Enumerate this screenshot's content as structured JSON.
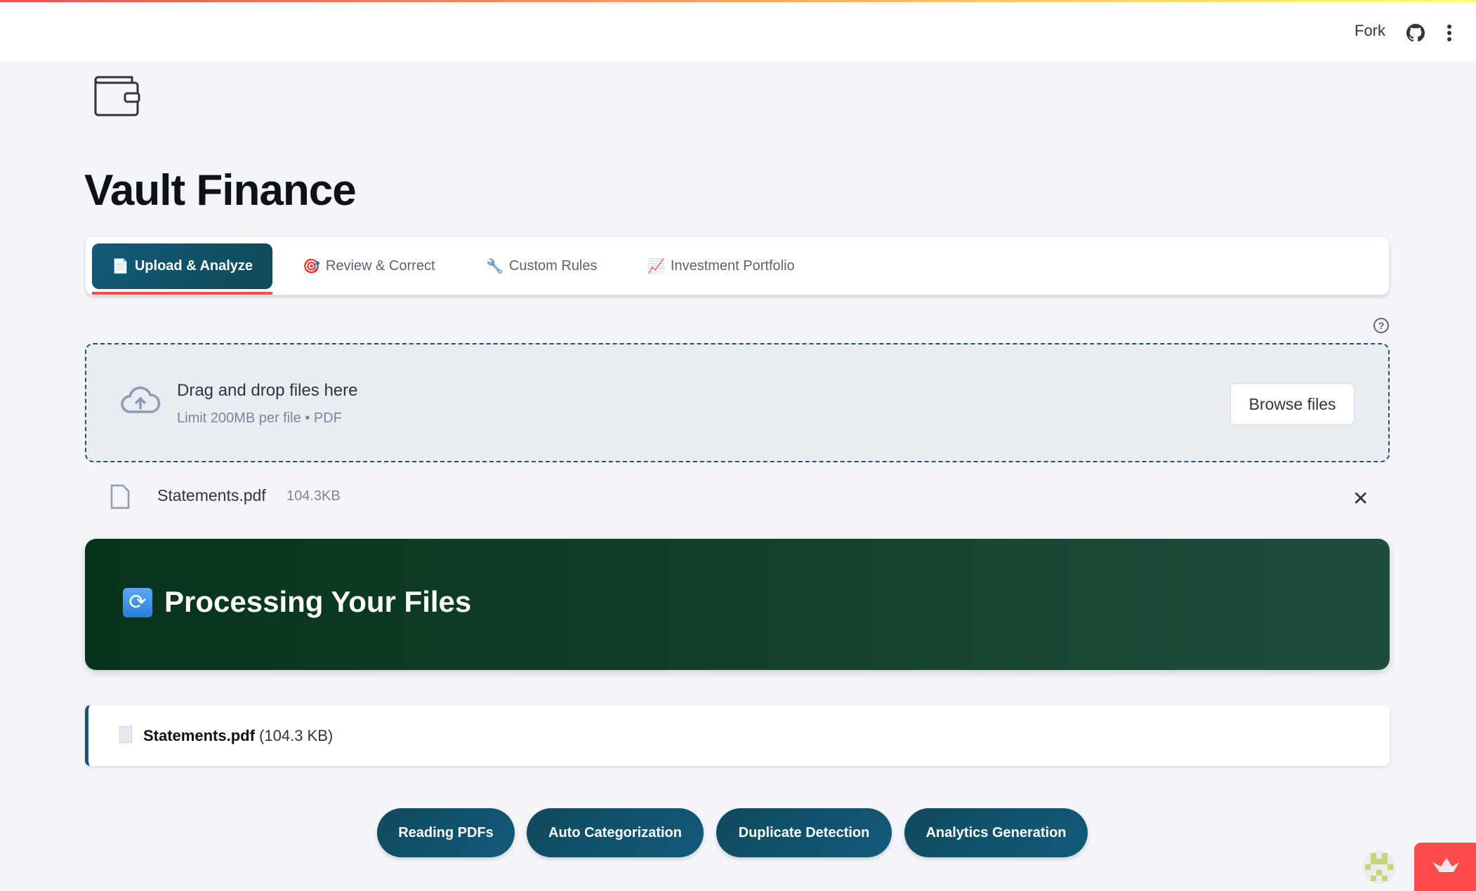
{
  "header": {
    "fork_label": "Fork"
  },
  "app": {
    "title": "Vault Finance"
  },
  "tabs": [
    {
      "icon": "📄",
      "label": "Upload & Analyze"
    },
    {
      "icon": "🎯",
      "label": "Review & Correct"
    },
    {
      "icon": "🔧",
      "label": "Custom Rules"
    },
    {
      "icon": "📈",
      "label": "Investment Portfolio"
    }
  ],
  "uploader": {
    "help": "?",
    "title": "Drag and drop files here",
    "subtitle": "Limit 200MB per file • PDF",
    "browse_label": "Browse files"
  },
  "uploaded_file": {
    "name": "Statements.pdf",
    "size": "104.3KB",
    "remove": "✕"
  },
  "banner": {
    "icon": "🔄",
    "title": "Processing Your Files"
  },
  "file_card": {
    "name": "Statements.pdf",
    "size": "(104.3 KB)"
  },
  "steps": [
    "Reading PDFs",
    "Auto Categorization",
    "Duplicate Detection",
    "Analytics Generation"
  ]
}
